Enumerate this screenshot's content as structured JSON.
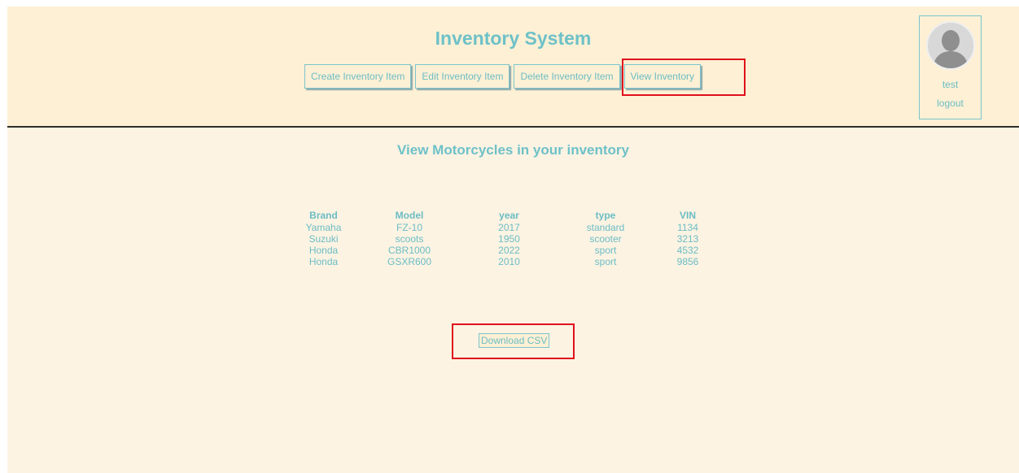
{
  "header": {
    "title": "Inventory System",
    "nav": [
      {
        "label": "Create Inventory Item"
      },
      {
        "label": "Edit Inventory Item"
      },
      {
        "label": "Delete Inventory Item"
      },
      {
        "label": "View Inventory"
      }
    ]
  },
  "user": {
    "avatar_icon": "user-avatar-icon",
    "name": "test",
    "logout_label": "logout"
  },
  "main": {
    "heading": "View Motorcycles in your inventory",
    "table": {
      "columns": [
        "Brand",
        "Model",
        "year",
        "type",
        "VIN"
      ],
      "rows": [
        [
          "Yamaha",
          "FZ-10",
          "2017",
          "standard",
          "1134"
        ],
        [
          "Suzuki",
          "scoots",
          "1950",
          "scooter",
          "3213"
        ],
        [
          "Honda",
          "CBR1000",
          "2022",
          "sport",
          "4532"
        ],
        [
          "Honda",
          "GSXR600",
          "2010",
          "sport",
          "9856"
        ]
      ]
    },
    "download_label": "Download CSV"
  },
  "colors": {
    "accent": "#6ec1c8",
    "header_bg": "#fdf0d5",
    "page_bg": "#fcf3e3",
    "highlight": "#e0101c"
  }
}
